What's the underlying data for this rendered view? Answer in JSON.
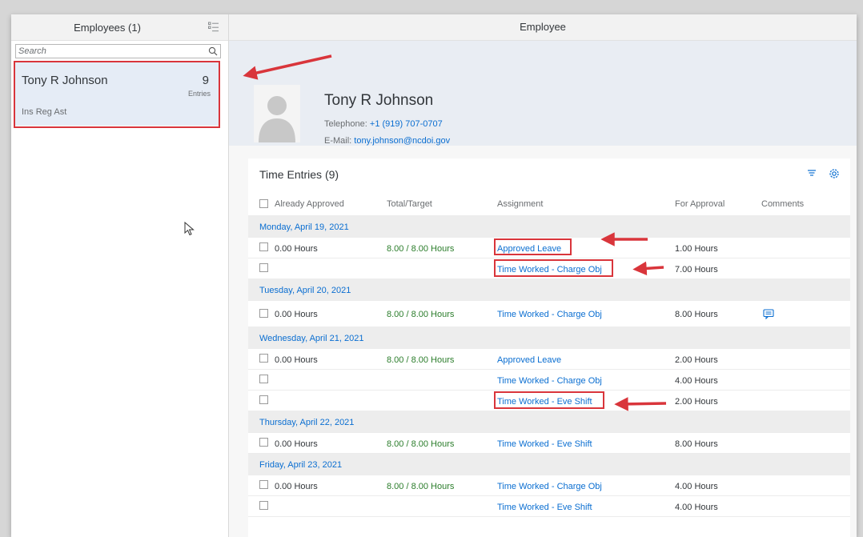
{
  "master": {
    "title": "Employees (1)",
    "search_placeholder": "Search",
    "employee": {
      "name": "Tony R Johnson",
      "entries_count": "9",
      "entries_label": "Entries",
      "job_title": "Ins Reg Ast"
    }
  },
  "detail": {
    "title": "Employee",
    "name": "Tony R Johnson",
    "telephone_label": "Telephone:",
    "telephone": "+1 (919) 707-0707",
    "email_label": "E-Mail:",
    "email": "tony.johnson@ncdoi.gov"
  },
  "table": {
    "title": "Time Entries (9)",
    "columns": [
      "Already Approved",
      "Total/Target",
      "Assignment",
      "For Approval",
      "Comments"
    ],
    "groups": [
      {
        "date": "Monday, April 19, 2021",
        "rows": [
          {
            "approved": "0.00 Hours",
            "total": "8.00 / 8.00 Hours",
            "assignment": "Approved Leave",
            "for_approval": "1.00 Hours",
            "has_comment": false
          },
          {
            "approved": "",
            "total": "",
            "assignment": "Time Worked - Charge Obj",
            "for_approval": "7.00 Hours",
            "has_comment": false
          }
        ]
      },
      {
        "date": "Tuesday, April 20, 2021",
        "rows": [
          {
            "approved": "0.00 Hours",
            "total": "8.00 / 8.00 Hours",
            "assignment": "Time Worked - Charge Obj",
            "for_approval": "8.00 Hours",
            "has_comment": true
          }
        ]
      },
      {
        "date": "Wednesday, April 21, 2021",
        "rows": [
          {
            "approved": "0.00 Hours",
            "total": "8.00 / 8.00 Hours",
            "assignment": "Approved Leave",
            "for_approval": "2.00 Hours",
            "has_comment": false
          },
          {
            "approved": "",
            "total": "",
            "assignment": "Time Worked - Charge Obj",
            "for_approval": "4.00 Hours",
            "has_comment": false
          },
          {
            "approved": "",
            "total": "",
            "assignment": "Time Worked - Eve Shift",
            "for_approval": "2.00 Hours",
            "has_comment": false
          }
        ]
      },
      {
        "date": "Thursday, April 22, 2021",
        "rows": [
          {
            "approved": "0.00 Hours",
            "total": "8.00 / 8.00 Hours",
            "assignment": "Time Worked - Eve Shift",
            "for_approval": "8.00 Hours",
            "has_comment": false
          }
        ]
      },
      {
        "date": "Friday, April 23, 2021",
        "rows": [
          {
            "approved": "0.00 Hours",
            "total": "8.00 / 8.00 Hours",
            "assignment": "Time Worked - Charge Obj",
            "for_approval": "4.00 Hours",
            "has_comment": false
          },
          {
            "approved": "",
            "total": "",
            "assignment": "Time Worked - Eve Shift",
            "for_approval": "4.00 Hours",
            "has_comment": false
          }
        ]
      }
    ]
  },
  "colors": {
    "accent": "#0a6ed1",
    "positive": "#2b7d2b",
    "annotation": "#d9353b",
    "selected_item": "#e5ecf6"
  }
}
